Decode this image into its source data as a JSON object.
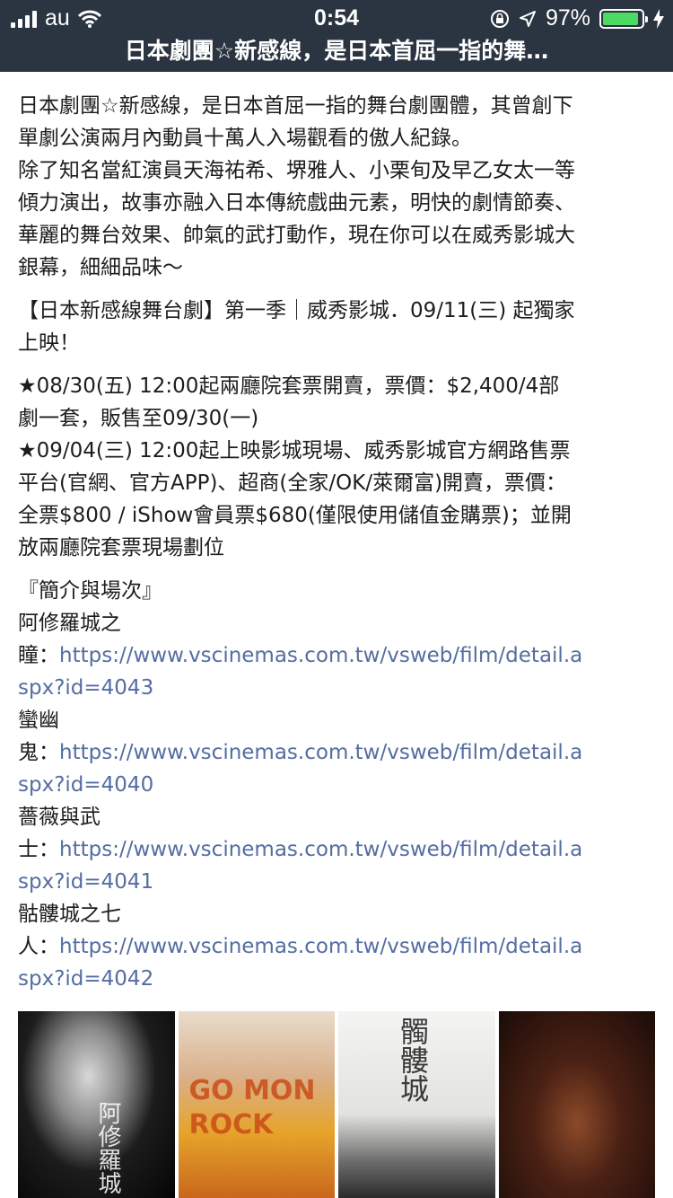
{
  "status": {
    "carrier": "au",
    "time": "0:54",
    "battery": "97%",
    "battery_level": 0.97
  },
  "nav": {
    "title": "日本劇團☆新感線，是日本首屈一指的舞…"
  },
  "article": {
    "p1_lines": [
      "日本劇團☆新感線，是日本首屈一指的舞台劇團體，其曾創下",
      "單劇公演兩月內動員十萬人入場觀看的傲人紀錄。",
      "除了知名當紅演員天海祐希、堺雅人、小栗旬及早乙女太一等",
      "傾力演出，故事亦融入日本傳統戲曲元素，明快的劇情節奏、",
      "華麗的舞台效果、帥氣的武打動作，現在你可以在威秀影城大",
      "銀幕，細細品味～"
    ],
    "p2_lines": [
      "【日本新感線舞台劇】第一季｜威秀影城．09/11(三) 起獨家",
      "上映！"
    ],
    "p3_lines": [
      "★08/30(五) 12:00起兩廳院套票開賣，票價：$2,400/4部",
      "劇一套，販售至09/30(一)",
      "★09/04(三) 12:00起上映影城現場、威秀影城官方網路售票",
      "平台(官網、官方APP)、超商(全家/OK/萊爾富)開賣，票價：",
      "全票$800 / iShow會員票$680(僅限使用儲值金購票)；並開",
      "放兩廳院套票現場劃位"
    ],
    "section_heading": "『簡介與場次』",
    "films": [
      {
        "title_a": "阿修羅城之",
        "title_b": "瞳：",
        "url_a": "https://www.vscinemas.com.tw/vsweb/film/detail.a",
        "url_b": "spx?id=4043"
      },
      {
        "title_a": "蠻幽",
        "title_b": "鬼：",
        "url_a": "https://www.vscinemas.com.tw/vsweb/film/detail.a",
        "url_b": "spx?id=4040"
      },
      {
        "title_a": "薔薇與武",
        "title_b": "士：",
        "url_a": "https://www.vscinemas.com.tw/vsweb/film/detail.a",
        "url_b": "spx?id=4041"
      },
      {
        "title_a": "骷髏城之七",
        "title_b": "人：",
        "url_a": "https://www.vscinemas.com.tw/vsweb/film/detail.a",
        "url_b": "spx?id=4042"
      }
    ]
  },
  "posters": {
    "p1_text": "阿修羅城",
    "p2_text": "GO MON ROCK",
    "p3_text": "髑髏城",
    "p4_text": ""
  }
}
